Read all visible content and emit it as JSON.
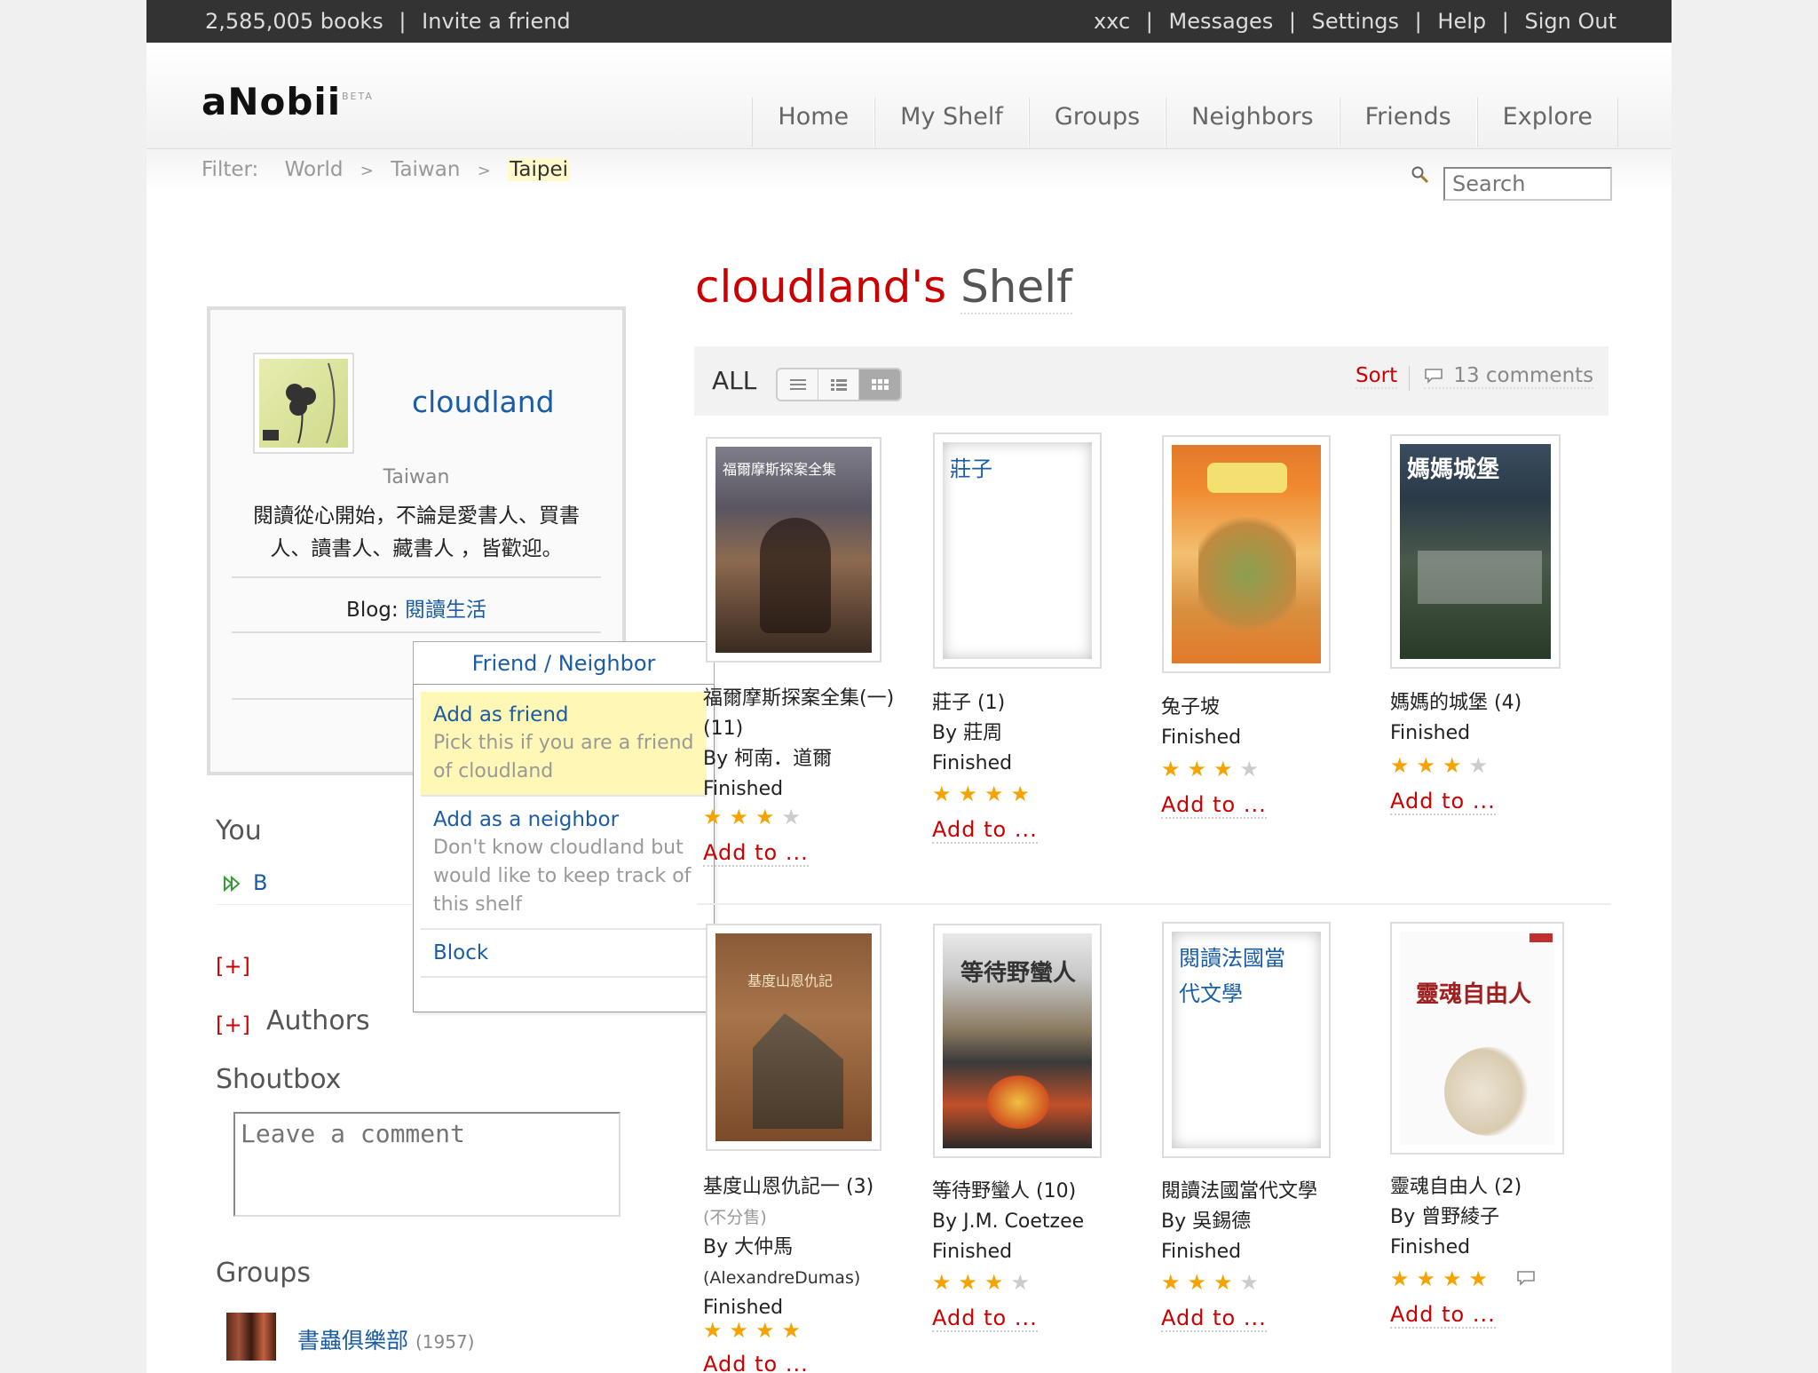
{
  "topbar": {
    "book_count": "2,585,005 books",
    "invite": "Invite a friend",
    "user": "xxc",
    "messages": "Messages",
    "settings": "Settings",
    "help": "Help",
    "signout": "Sign Out",
    "sep": "|"
  },
  "header": {
    "logo": "aNobii",
    "beta": "BETA",
    "nav": [
      "Home",
      "My Shelf",
      "Groups",
      "Neighbors",
      "Friends",
      "Explore"
    ]
  },
  "filter": {
    "label": "Filter:",
    "crumbs": [
      "World",
      "Taiwan",
      "Taipei"
    ],
    "gt": ">"
  },
  "search": {
    "placeholder": "Search"
  },
  "profile": {
    "username": "cloudland",
    "location": "Taiwan",
    "bio_line1": "閱讀從心開始，不論是愛書人、買書",
    "bio_line2": "人、讀書人、藏書人 ，皆歡迎。",
    "blog_label": "Blog:",
    "blog_link": "閱讀生活"
  },
  "dropdown": {
    "trigger": "Friend / Neighbor",
    "add_friend_title": "Add as friend",
    "add_friend_desc": "Pick this if you are a friend of cloudland",
    "add_neighbor_title": "Add as a neighbor",
    "add_neighbor_desc": "Don't know cloudland but would like to keep track of this shelf",
    "block": "Block"
  },
  "sidebar": {
    "you": "You",
    "you_b": "B",
    "plus": "[+]",
    "authors": "Authors",
    "shoutbox": "Shoutbox",
    "shoutbox_placeholder": "Leave a comment",
    "groups": "Groups",
    "group_name": "書蟲俱樂部",
    "group_count": "(1957)"
  },
  "shelf": {
    "owner": "cloudland's",
    "word": "Shelf",
    "all": "ALL",
    "sort": "Sort",
    "comments": "13 comments"
  },
  "colors": {
    "accent_red": "#cc0000",
    "link_blue": "#1a5ca5",
    "star": "#f5a300"
  },
  "books": [
    {
      "title": "福爾摩斯探案全集(一)",
      "title2": "(11)",
      "author": "By 柯南．道爾",
      "status": "Finished",
      "rating": 3,
      "add": "Add to ..."
    },
    {
      "title": "莊子 (1)",
      "cover_text": "莊子",
      "author": "By 莊周",
      "status": "Finished",
      "rating": 4,
      "add": "Add to ..."
    },
    {
      "title": "兔子坡",
      "status": "Finished",
      "rating": 3,
      "add": "Add to ..."
    },
    {
      "title": "媽媽的城堡 (4)",
      "status": "Finished",
      "rating": 3,
      "add": "Add to ..."
    },
    {
      "title": "基度山恩仇記一 (3)",
      "subtitle": "(不分售)",
      "author": "By 大仲馬",
      "author2": "(AlexandreDumas)",
      "status": "Finished",
      "rating": 4,
      "add": "Add to ..."
    },
    {
      "title": "等待野蠻人 (10)",
      "author": "By J.M. Coetzee",
      "status": "Finished",
      "rating": 3,
      "add": "Add to ..."
    },
    {
      "title": "閱讀法國當代文學",
      "cover_text1": "閱讀法國當",
      "cover_text2": "代文學",
      "author": "By 吳錫德",
      "status": "Finished",
      "rating": 3,
      "add": "Add to ..."
    },
    {
      "title": "靈魂自由人 (2)",
      "author": "By 曾野綾子",
      "status": "Finished",
      "rating": 4,
      "add": "Add to ..."
    }
  ],
  "star_glyph": "★"
}
